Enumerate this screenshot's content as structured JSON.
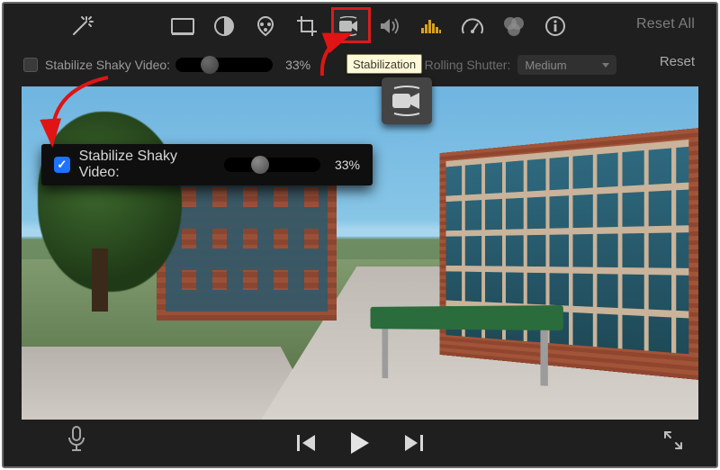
{
  "toolbar": {
    "reset_all": "Reset All",
    "tooltip": "Stabilization",
    "icons": {
      "wand": "magic-wand-icon",
      "frame": "frame-aspect-icon",
      "contrast": "color-balance-icon",
      "palette": "color-correction-icon",
      "crop": "crop-icon",
      "camera": "stabilization-icon",
      "speaker": "volume-icon",
      "eq": "noise-equalizer-icon",
      "speed": "speed-gauge-icon",
      "overlay": "clip-filter-icon",
      "info": "info-icon"
    }
  },
  "settings": {
    "stabilize_label": "Stabilize Shaky Video:",
    "stabilize_pct": "33%",
    "rolling_label": "Fix Rolling Shutter:",
    "rolling_value": "Medium",
    "reset": "Reset"
  },
  "zoom": {
    "stabilize_label": "Stabilize Shaky Video:",
    "stabilize_pct": "33%"
  },
  "transport": {
    "prev": "previous-frame",
    "play": "play",
    "next": "next-frame"
  }
}
